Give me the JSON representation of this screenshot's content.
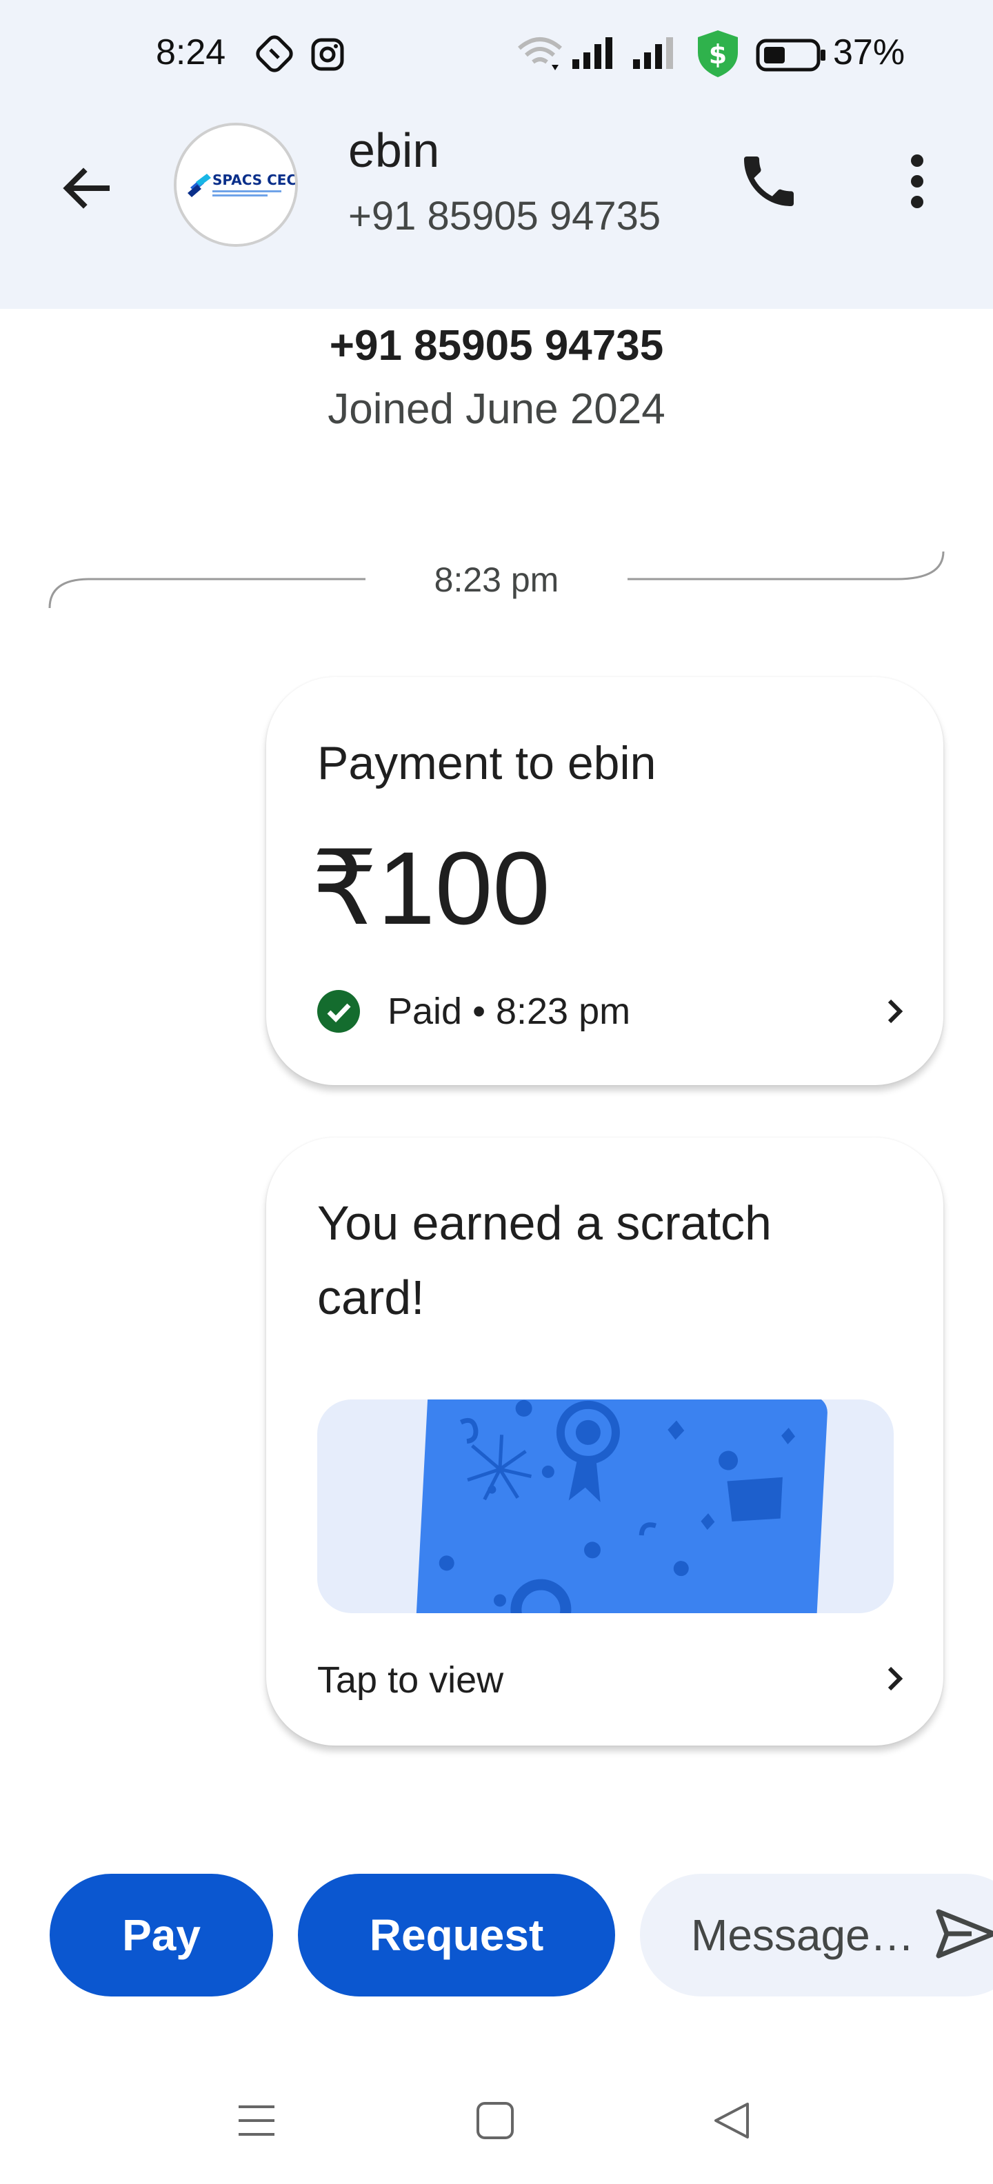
{
  "status_bar": {
    "time": "8:24",
    "battery_percent": "37%",
    "icons": [
      "shazam-icon",
      "instagram-icon",
      "wifi-icon",
      "signal-icon",
      "signal-icon",
      "security-shield-icon",
      "battery-icon"
    ],
    "shield_color": "#2fb24c"
  },
  "header": {
    "contact_name": "ebin",
    "contact_phone": "+91 85905 94735",
    "avatar_logo_text": "SPACS CEC",
    "back_icon": "arrow-back-icon",
    "call_icon": "phone-icon",
    "more_icon": "more-vert-icon"
  },
  "profile": {
    "phone": "+91 85905 94735",
    "joined": "Joined June 2024"
  },
  "conversation": {
    "divider_time": "8:23 pm",
    "payment_card": {
      "title": "Payment to ebin",
      "amount": "₹100",
      "status": "Paid • 8:23 pm",
      "status_color": "#146c2e"
    },
    "scratch_card": {
      "title": "You earned a scratch card!",
      "action": "Tap to view",
      "card_color": "#3b82f0"
    }
  },
  "actions": {
    "pay_label": "Pay",
    "request_label": "Request",
    "message_placeholder": "Message…",
    "accent_color": "#0b57d0"
  },
  "nav": {
    "items": [
      "recents-icon",
      "home-icon",
      "back-icon"
    ]
  }
}
